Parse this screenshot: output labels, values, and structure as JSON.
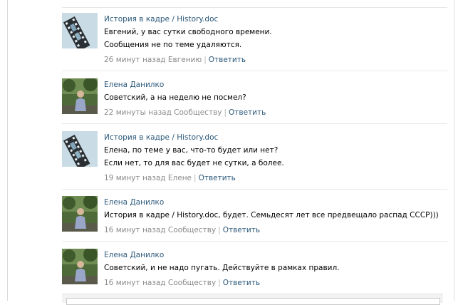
{
  "comments": [
    {
      "author": "История в кадре / History.doc",
      "avatar": "film-reel-avatar",
      "lines": [
        "Евгений, у вас сутки свободного времени.",
        "Сообщения не по теме удаляются."
      ],
      "time": "26 минут назад Евгению",
      "reply": "Ответить"
    },
    {
      "author": "Елена Данилко",
      "avatar": "person-photo-avatar",
      "lines": [
        "Советский, а на неделю не посмел?"
      ],
      "time": "22 минуты назад Сообществу",
      "reply": "Ответить"
    },
    {
      "author": "История в кадре / History.doc",
      "avatar": "film-reel-avatar",
      "lines": [
        "Елена, по теме у вас, что-то будет или нет?",
        "Если нет, то для вас будет не сутки, а более."
      ],
      "time": "19 минут назад Елене",
      "reply": "Ответить"
    },
    {
      "author": "Елена Данилко",
      "avatar": "person-photo-avatar",
      "lines": [
        "История в кадре / History.doc, будет. Семьдесят лет все предвещало распад СССР)))"
      ],
      "time": "16 минут назад Сообществу",
      "reply": "Ответить"
    },
    {
      "author": "Елена Данилко",
      "avatar": "person-photo-avatar",
      "lines": [
        "Советский, и не надо пугать. Действуйте в рамках правил."
      ],
      "time": "16 минут назад Сообществу",
      "reply": "Ответить"
    }
  ],
  "colors": {
    "link": "#2b587a",
    "meta": "#8a8a8a",
    "divider": "#e9e9e9"
  }
}
